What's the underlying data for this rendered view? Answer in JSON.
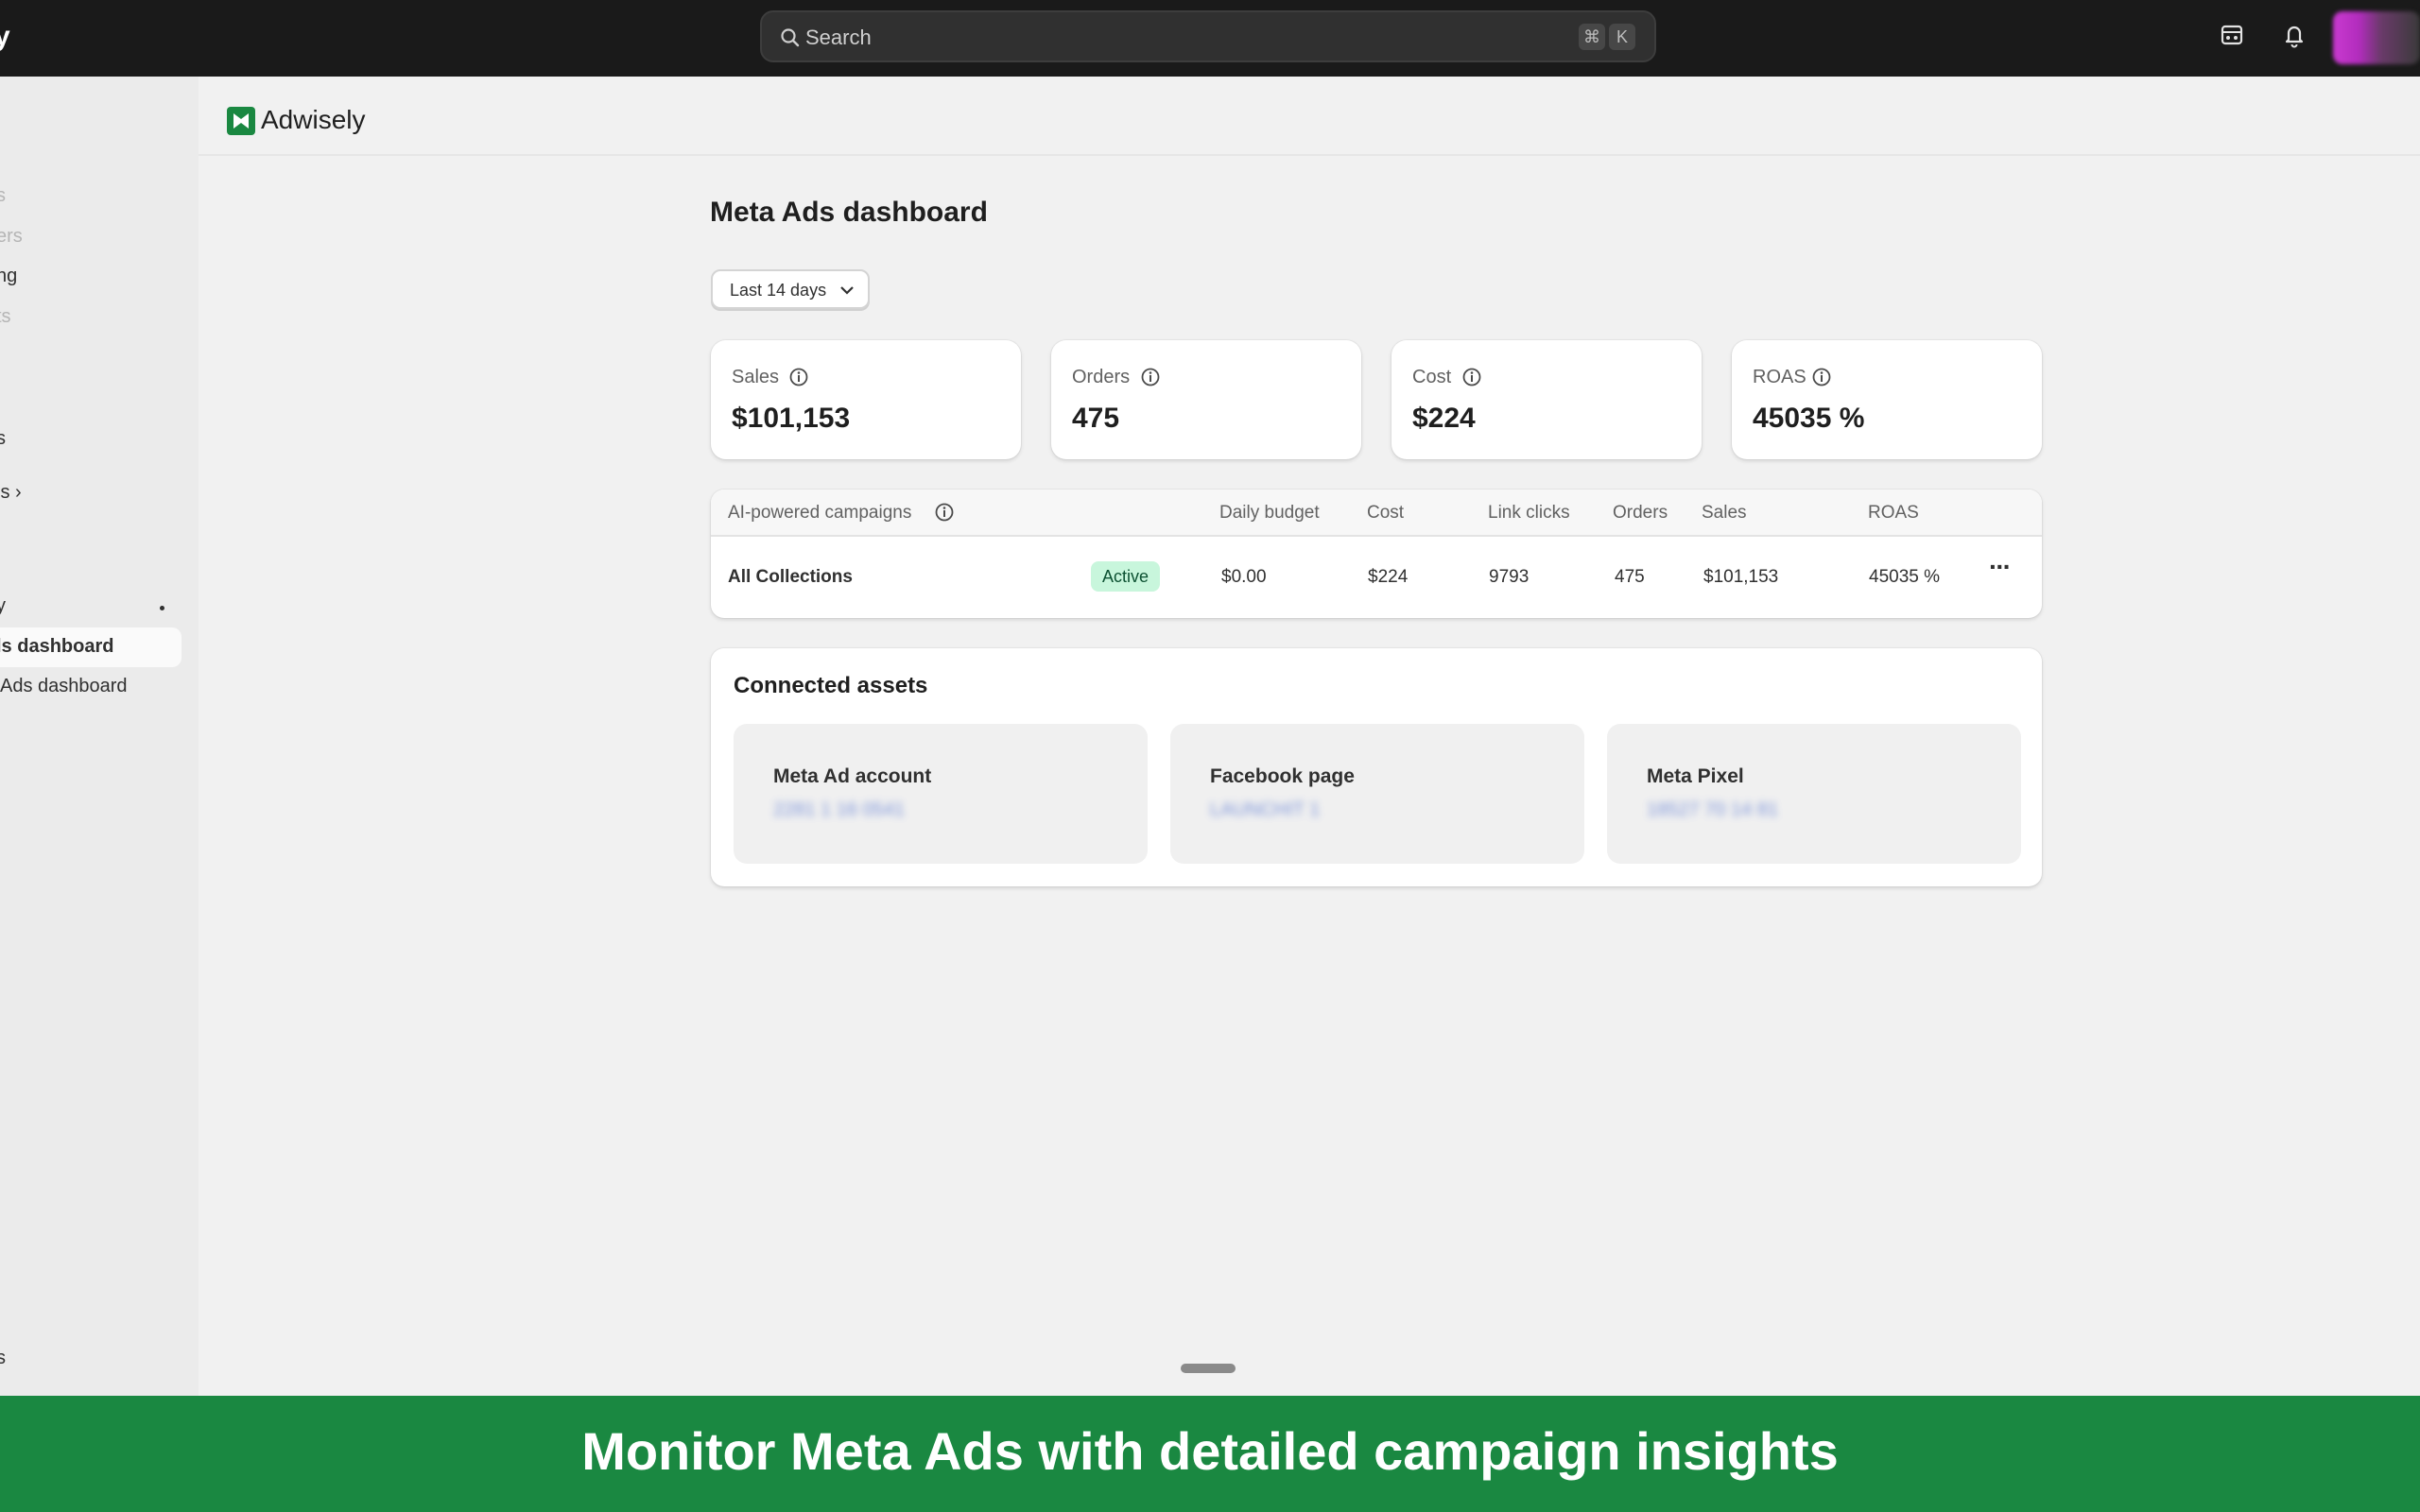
{
  "topbar": {
    "brand_fragment": "y",
    "search_placeholder": "Search",
    "shortcut_cmd": "⌘",
    "shortcut_key": "K"
  },
  "sidebar": {
    "items": [
      {
        "label": "s"
      },
      {
        "label": "ers"
      },
      {
        "label": "ng"
      },
      {
        "label": "ts"
      },
      {
        "label": "s"
      },
      {
        "label": "ls ›"
      },
      {
        "label": "y"
      },
      {
        "label": "ls dashboard"
      },
      {
        "label": "Ads dashboard"
      },
      {
        "label": "s"
      }
    ]
  },
  "app": {
    "name": "Adwisely",
    "brand_color": "#1a8841"
  },
  "page": {
    "title": "Meta Ads dashboard",
    "date_range": "Last 14 days"
  },
  "metrics": [
    {
      "label": "Sales",
      "value": "$101,153"
    },
    {
      "label": "Orders",
      "value": "475"
    },
    {
      "label": "Cost",
      "value": "$224"
    },
    {
      "label": "ROAS",
      "value": "45035 %"
    }
  ],
  "campaigns": {
    "headers": {
      "name": "AI-powered campaigns",
      "daily_budget": "Daily budget",
      "cost": "Cost",
      "link_clicks": "Link clicks",
      "orders": "Orders",
      "sales": "Sales",
      "roas": "ROAS"
    },
    "rows": [
      {
        "name": "All Collections",
        "status": "Active",
        "daily_budget": "$0.00",
        "cost": "$224",
        "link_clicks": "9793",
        "orders": "475",
        "sales": "$101,153",
        "roas": "45035 %",
        "more": "···"
      }
    ]
  },
  "assets": {
    "title": "Connected assets",
    "items": [
      {
        "name": "Meta Ad account",
        "value": "2281 1 16 0541"
      },
      {
        "name": "Facebook page",
        "value": "LAUNCHIT 1"
      },
      {
        "name": "Meta Pixel",
        "value": "18527 70 14 81"
      }
    ]
  },
  "banner": {
    "text": "Monitor Meta Ads with detailed campaign insights"
  }
}
